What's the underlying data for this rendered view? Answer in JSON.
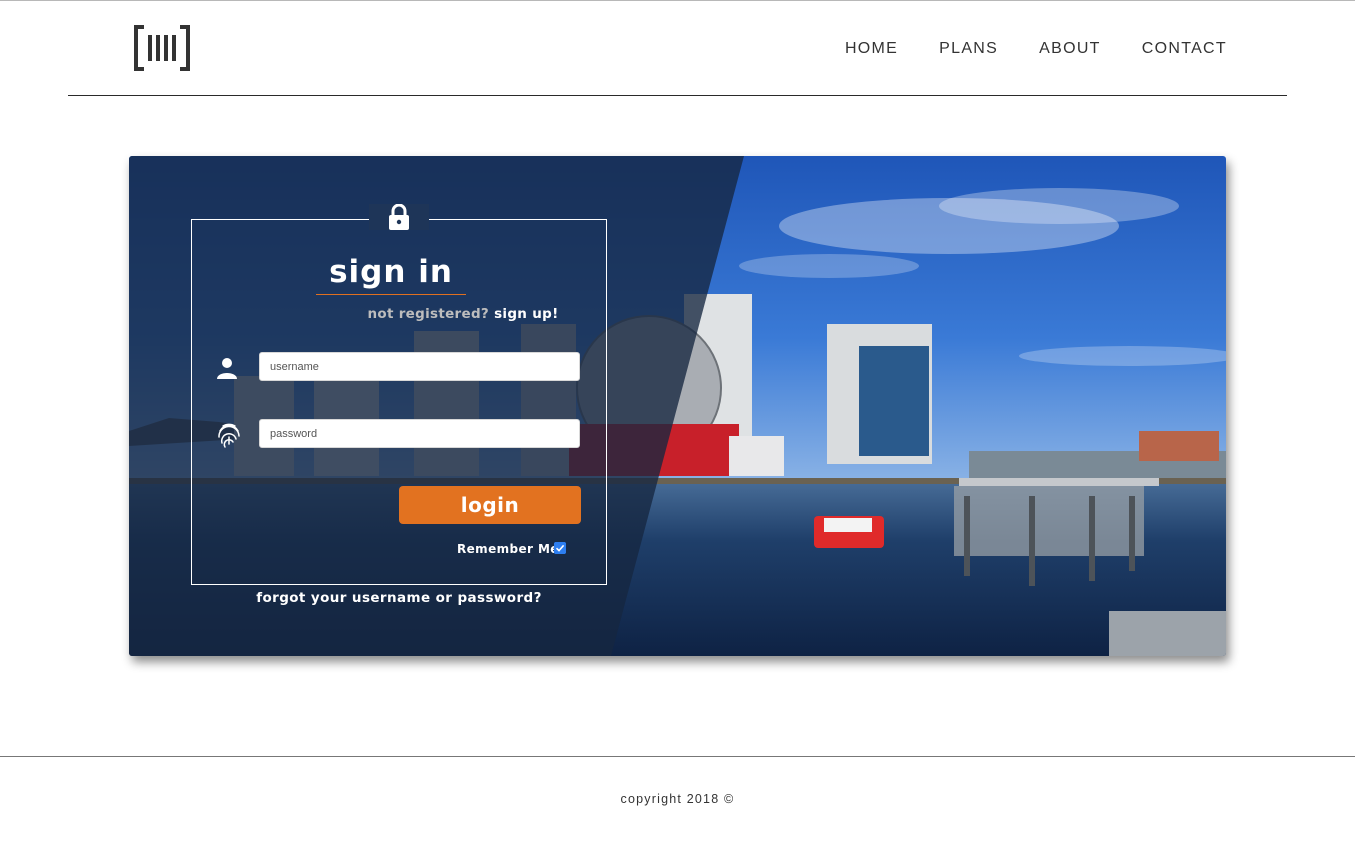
{
  "nav": {
    "items": [
      {
        "label": "HOME"
      },
      {
        "label": "PLANS"
      },
      {
        "label": "ABOUT"
      },
      {
        "label": "CONTACT"
      }
    ]
  },
  "login": {
    "title": "sign in",
    "not_registered": "not registered?",
    "sign_up": "sign up!",
    "username_placeholder": "username",
    "password_placeholder": "password",
    "login_button": "login",
    "remember_me": "Remember Me",
    "remember_checked": true,
    "forgot": "forgot your username or password?"
  },
  "footer": {
    "copyright": "copyright 2018 ©"
  },
  "colors": {
    "accent": "#e27220",
    "overlay": "#162640",
    "text_dark": "#333333"
  },
  "icons": [
    "logo-icon",
    "lock-icon",
    "user-icon",
    "fingerprint-icon",
    "checkbox-checked-icon"
  ]
}
